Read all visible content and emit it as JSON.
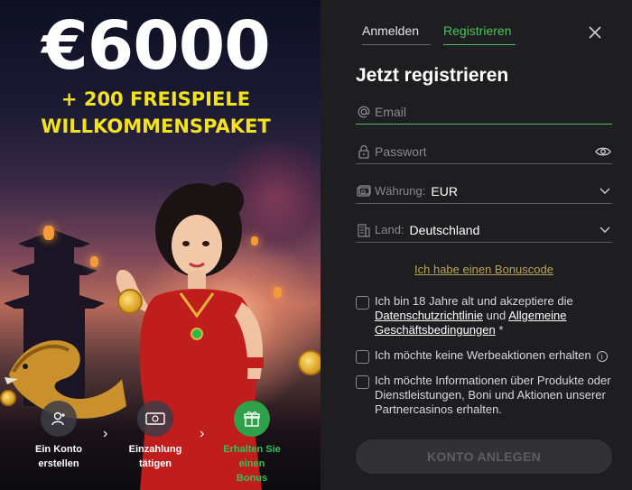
{
  "promo": {
    "amount": "€6000",
    "line1": "+ 200 FREISPIELE",
    "line2": "WILLKOMMENSPAKET",
    "steps": [
      {
        "label_1": "Ein Konto",
        "label_2": "erstellen",
        "icon": "user-add-icon"
      },
      {
        "label_1": "Einzahlung",
        "label_2": "tätigen",
        "icon": "banknote-icon"
      },
      {
        "label_1": "Erhalten Sie einen",
        "label_2": "Bonus",
        "icon": "gift-icon"
      }
    ]
  },
  "tabs": {
    "login": "Anmelden",
    "register": "Registrieren"
  },
  "form": {
    "title": "Jetzt registrieren",
    "email_placeholder": "Email",
    "password_placeholder": "Passwort",
    "currency_label": "Währung:",
    "currency_value": "EUR",
    "country_label": "Land:",
    "country_value": "Deutschland",
    "bonus_link": "Ich habe einen Bonuscode",
    "consent": {
      "prefix": "Ich bin 18 Jahre alt und akzeptiere die",
      "privacy_link": "Datenschutzrichtlinie",
      "and": "und",
      "terms_link_1": "Allgemeine",
      "terms_link_2": "Geschäftsbedingungen",
      "required": "*"
    },
    "no_promos": "Ich möchte keine Werbeaktionen erhalten",
    "partner_info": "Ich möchte Informationen über Produkte oder Dienstleistungen, Boni und Aktionen unserer Partnercasinos erhalten.",
    "submit": "KONTO ANLEGEN"
  },
  "colors": {
    "accent_green": "#4cc25f",
    "promo_yellow": "#f4e21c",
    "bonus_link": "#b9a25a",
    "panel_bg": "#1e1e20"
  }
}
